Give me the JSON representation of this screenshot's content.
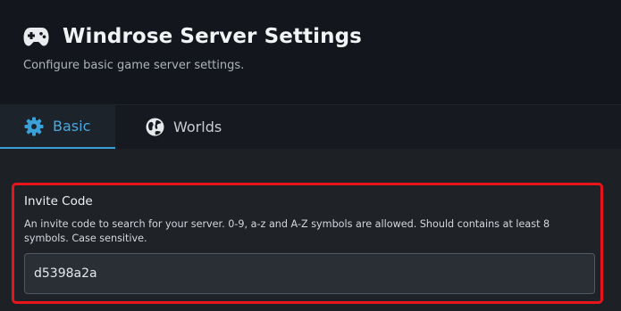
{
  "header": {
    "title": "Windrose Server Settings",
    "subtitle": "Configure basic game server settings.",
    "icon": "gamepad-icon"
  },
  "tabs": [
    {
      "label": "Basic",
      "icon": "gear-icon",
      "active": true
    },
    {
      "label": "Worlds",
      "icon": "globe-icon",
      "active": false
    }
  ],
  "invite_code": {
    "label": "Invite Code",
    "description": "An invite code to search for your server. 0-9, a-z and A-Z symbols are allowed. Should contains at least 8 symbols. Case sensitive.",
    "value": "d5398a2a"
  },
  "colors": {
    "accent": "#3aa0d8",
    "highlight_border": "#e8141c"
  }
}
